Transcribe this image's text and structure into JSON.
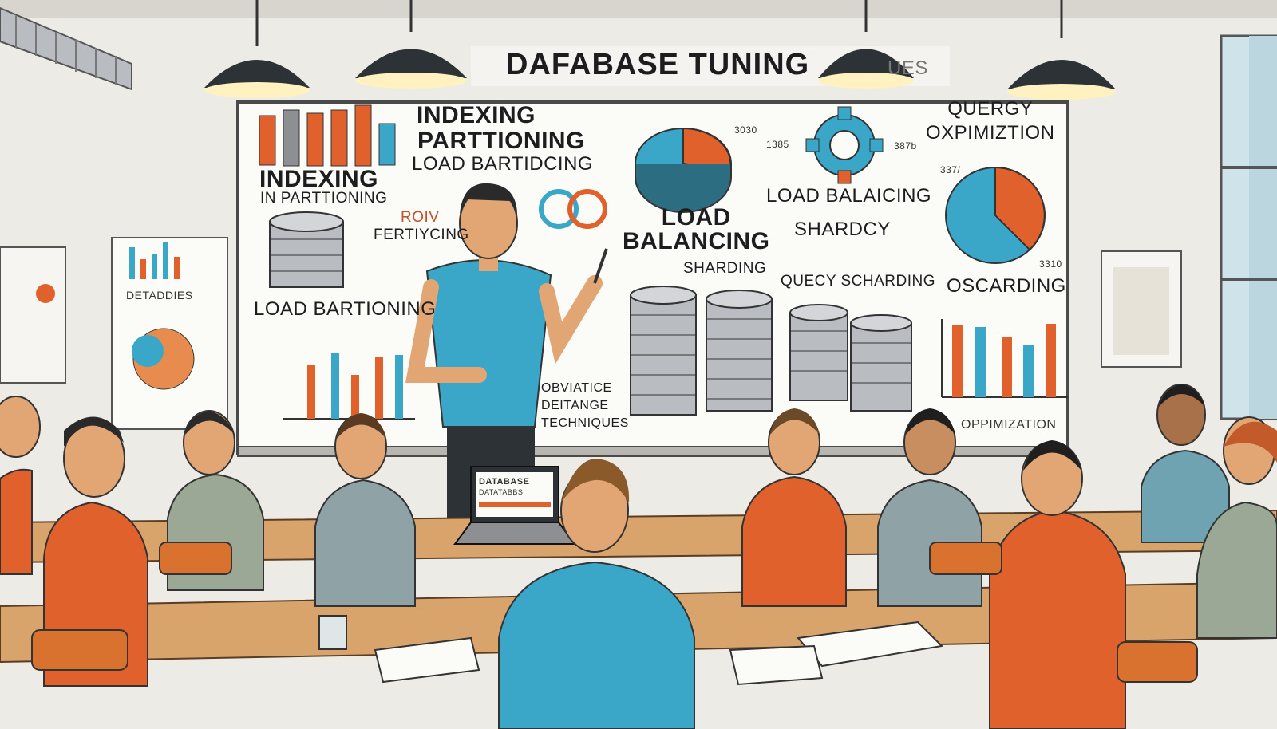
{
  "banner": {
    "title": "DAFABASE TUNING",
    "suffix": "UES"
  },
  "board_labels": {
    "indexing_top": "INDEXING",
    "partitioning_top": "PARTTIONING",
    "load_bartidcing": "LOAD BARTIDCING",
    "indexing_left": "INDEXING",
    "in_partitioning": "IN PARTTIONING",
    "roiv": "ROIV",
    "fertiycing": "FERTIYCING",
    "load_bartioning": "LOAD BARTIONING",
    "load_balancing_center": "LOAD\nBALANCING",
    "sharding_small": "SHARDING",
    "load_balancing_right": "LOAD BALAICING",
    "shardcy": "SHARDCY",
    "query_sharding": "QUECY SCHARDING",
    "oscarding": "OSCARDING",
    "query_optimization": "QUERGY\nOXPIMIZTION",
    "optimization_bottom": "OPPIMIZATION",
    "techniques": "OBVIATICE\nDEITANGE\nTECHNIQUES",
    "num_3030": "3030",
    "num_1385": "1385",
    "num_3870": "387b",
    "num_337": "337/",
    "num_3310": "3310"
  },
  "poster_left": {
    "title": "DETADDIES"
  },
  "laptop": {
    "screen_line1": "DATABASE",
    "screen_line2": "DATATABBS"
  },
  "colors": {
    "orange": "#e0612b",
    "teal": "#3aa7c9",
    "wall": "#efede7",
    "desk": "#d9a46c",
    "board": "#fbfbf8"
  }
}
